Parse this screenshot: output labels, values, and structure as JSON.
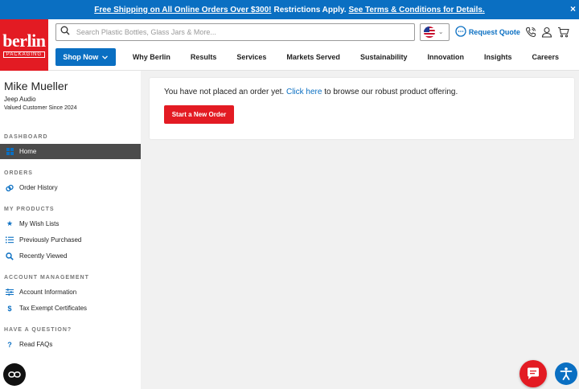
{
  "promo": {
    "part1": "Free Shipping on All Online Orders Over $300!",
    "part2": "Restrictions Apply.",
    "part3": "See Terms & Conditions for Details.",
    "close": "×"
  },
  "logo": {
    "word": "berlin",
    "sub": "PACKAGING"
  },
  "search": {
    "placeholder": "Search Plastic Bottles, Glass Jars & More..."
  },
  "header": {
    "request_quote": "Request Quote",
    "shop_now": "Shop Now",
    "nav": [
      "Why Berlin",
      "Results",
      "Services",
      "Markets Served",
      "Sustainability",
      "Innovation",
      "Insights",
      "Careers"
    ]
  },
  "account": {
    "name": "Mike Mueller",
    "company": "Jeep Audio",
    "since": "Valued Customer Since 2024"
  },
  "sidebar": {
    "dashboard_title": "DASHBOARD",
    "home": "Home",
    "orders_title": "ORDERS",
    "order_history": "Order History",
    "products_title": "MY PRODUCTS",
    "wish_lists": "My Wish Lists",
    "previously_purchased": "Previously Purchased",
    "recently_viewed": "Recently Viewed",
    "account_title": "ACCOUNT MANAGEMENT",
    "account_info": "Account Information",
    "tax_exempt": "Tax Exempt Certificates",
    "question_title": "HAVE A QUESTION?",
    "faqs": "Read FAQs"
  },
  "main": {
    "msg_before": "You have not placed an order yet.",
    "msg_link": "Click here",
    "msg_after": "to browse our robust product offering.",
    "start_button": "Start a New Order"
  },
  "colors": {
    "brand_blue": "#0a6fc2",
    "brand_red": "#e31b23"
  }
}
